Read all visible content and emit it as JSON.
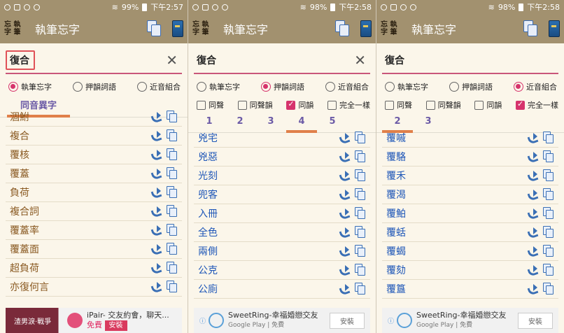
{
  "status": {
    "panel1": {
      "battery": "99%",
      "time": "下午2:57"
    },
    "panel2": {
      "battery": "98%",
      "time": "下午2:58"
    },
    "panel3": {
      "battery": "98%",
      "time": "下午2:58"
    }
  },
  "app": {
    "logo": "忘執\n字筆",
    "title": "執筆忘字"
  },
  "search": {
    "value": "復合"
  },
  "radios": [
    {
      "label": "執筆忘字"
    },
    {
      "label": "押韻詞語"
    },
    {
      "label": "近音組合"
    }
  ],
  "checks": [
    {
      "label": "同聲"
    },
    {
      "label": "同聲韻"
    },
    {
      "label": "同韻"
    },
    {
      "label": "完全一樣"
    }
  ],
  "panel1": {
    "tab": "同音異字",
    "words": [
      "涸鮒",
      "複合",
      "覆核",
      "覆蓋",
      "負荷",
      "複合詞",
      "覆蓋率",
      "覆蓋面",
      "超負荷",
      "亦復何言"
    ],
    "ad": {
      "thumb": "渣男淚·戰爭",
      "title": "iPair- 交友約會，聊天...",
      "free": "免費",
      "install": "安裝"
    }
  },
  "panel2": {
    "tabs": [
      "1",
      "2",
      "3",
      "4",
      "5"
    ],
    "active_tab": "4",
    "words": [
      "兇宅",
      "兇惡",
      "光刻",
      "兜客",
      "入冊",
      "全色",
      "兩側",
      "公克",
      "公廁"
    ],
    "ad": {
      "title": "SweetRing-幸福婚戀交友",
      "sub1": "Google Play",
      "sub2": "免費",
      "install": "安裝"
    }
  },
  "panel3": {
    "tabs": [
      "2",
      "3"
    ],
    "active_tab": "2",
    "words": [
      "覆嘁",
      "覆駱",
      "覆禾",
      "覆渴",
      "覆鮊",
      "覆蛞",
      "覆蝎",
      "覆劾",
      "覆簋"
    ],
    "ad": {
      "title": "SweetRing-幸福婚戀交友",
      "sub1": "Google Play",
      "sub2": "免費",
      "install": "安裝"
    }
  },
  "colors": {
    "header": "#a2916f",
    "accent": "#d6336c",
    "tab_indicator": "#e0804a",
    "word_brown": "#8a5a22",
    "word_blue": "#1f57b8"
  }
}
